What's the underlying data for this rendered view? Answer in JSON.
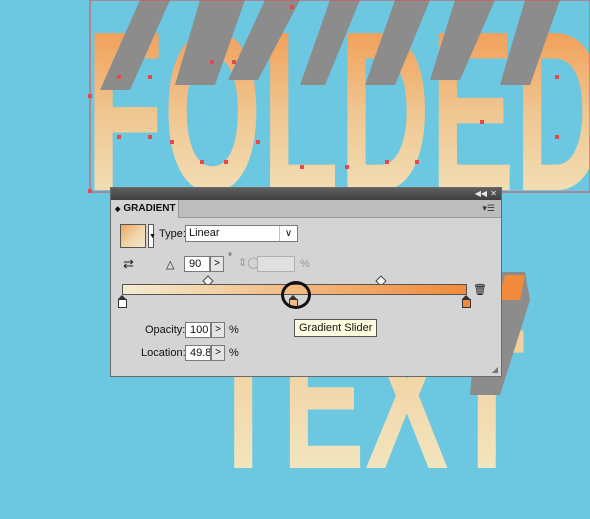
{
  "canvas": {
    "line1": "FOLDED",
    "line2": "TEXT",
    "colors": {
      "background": "#6cc7e0",
      "gradient_top": "#f28a3a",
      "gradient_bottom": "#f3ecc9",
      "shadow_gray": "#8c8c8c",
      "path_red": "#e8474c"
    }
  },
  "panel": {
    "collapse_icon": "double-chevron-icon",
    "close_icon": "close-icon",
    "tab_icon": "double-arrow-icon",
    "title": "GRADIENT",
    "menu_icon": "panel-menu-icon",
    "type_label": "Type:",
    "type_value": "Linear",
    "reverse_icon": "reverse-gradient-icon",
    "angle_icon": "angle-icon",
    "angle_value": "90",
    "degree_symbol": "°",
    "aspect_icon": "aspect-ratio-icon",
    "aspect_unit": "%",
    "stops": [
      {
        "name": "left-stop",
        "color": "#ffffff",
        "location": 0
      },
      {
        "name": "middle-stop",
        "color": "#f3ba80",
        "location": 49.86
      },
      {
        "name": "right-stop",
        "color": "#f28a3a",
        "location": 100
      }
    ],
    "midpoints": [
      25,
      75
    ],
    "delete_icon": "trash-icon",
    "opacity_label": "Opacity:",
    "opacity_value": "100",
    "opacity_unit": "%",
    "location_label": "Location:",
    "location_value": "49.86",
    "location_unit": "%",
    "tooltip": "Gradient Slider",
    "resize_icon": "resize-grip-icon"
  }
}
